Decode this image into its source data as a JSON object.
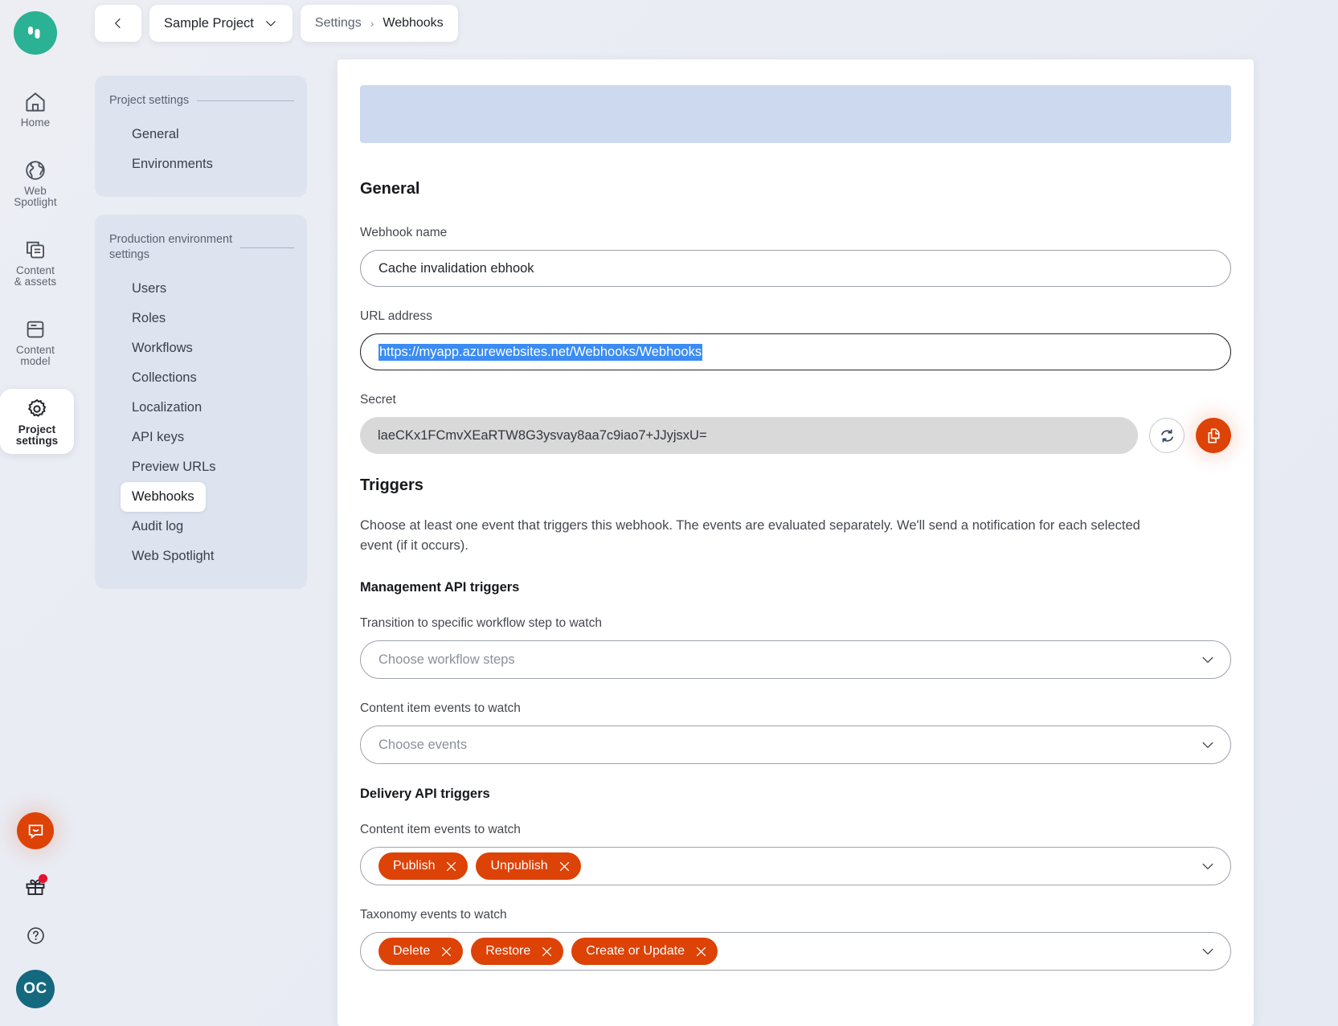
{
  "brand": {
    "logo_color": "#2bb193",
    "accent": "#dd4206",
    "avatar_color": "#15697f"
  },
  "topbar": {
    "back_icon": "chevron-left-icon",
    "project_name": "Sample Project",
    "project_chevron": "chevron-down-icon",
    "breadcrumb": {
      "parent": "Settings",
      "separator": "›",
      "current": "Webhooks"
    }
  },
  "rail": {
    "items": [
      {
        "label": "Home",
        "icon": "home-icon",
        "active": false
      },
      {
        "label": "Web\nSpotlight",
        "icon": "globe-icon",
        "active": false
      },
      {
        "label": "Content\n& assets",
        "icon": "documents-icon",
        "active": false
      },
      {
        "label": "Content\nmodel",
        "icon": "model-icon",
        "active": false
      },
      {
        "label": "Project\nsettings",
        "icon": "gear-icon",
        "active": true
      }
    ],
    "bottom": {
      "chat_icon": "chat-bubble-icon",
      "gift_icon": "gift-icon",
      "gift_badge": true,
      "help_icon": "question-mark-icon",
      "avatar_initials": "OC"
    }
  },
  "settings_nav": {
    "groups": [
      {
        "title": "Project settings",
        "links": [
          {
            "label": "General",
            "active": false
          },
          {
            "label": "Environments",
            "active": false
          }
        ]
      },
      {
        "title": "Production environment\nsettings",
        "links": [
          {
            "label": "Users",
            "active": false
          },
          {
            "label": "Roles",
            "active": false
          },
          {
            "label": "Workflows",
            "active": false
          },
          {
            "label": "Collections",
            "active": false
          },
          {
            "label": "Localization",
            "active": false
          },
          {
            "label": "API keys",
            "active": false
          },
          {
            "label": "Preview URLs",
            "active": false
          },
          {
            "label": "Webhooks",
            "active": true
          },
          {
            "label": "Audit log",
            "active": false
          },
          {
            "label": "Web Spotlight",
            "active": false
          }
        ]
      }
    ]
  },
  "main": {
    "general": {
      "heading": "General",
      "name_label": "Webhook name",
      "name_value": "Cache invalidation ebhook",
      "url_label": "URL address",
      "url_value": "https://myapp.azurewebsites.net/Webhooks/Webhooks",
      "url_selected": true,
      "secret_label": "Secret",
      "secret_value": "laeCKx1FCmvXEaRTW8G3ysvay8aa7c9iao7+JJyjsxU=",
      "regenerate_icon": "refresh-icon",
      "copy_icon": "copy-icon"
    },
    "triggers": {
      "heading": "Triggers",
      "description": "Choose at least one event that triggers this webhook. The events are evaluated separately. We'll send a notification for each selected event (if it occurs).",
      "management": {
        "heading": "Management API triggers",
        "workflow_label": "Transition to specific workflow step to watch",
        "workflow_placeholder": "Choose workflow steps",
        "content_label": "Content item events to watch",
        "content_placeholder": "Choose events"
      },
      "delivery": {
        "heading": "Delivery API triggers",
        "content_label": "Content item events to watch",
        "content_chips": [
          "Publish",
          "Unpublish"
        ],
        "taxonomy_label": "Taxonomy events to watch",
        "taxonomy_chips": [
          "Delete",
          "Restore",
          "Create or Update"
        ]
      }
    }
  }
}
